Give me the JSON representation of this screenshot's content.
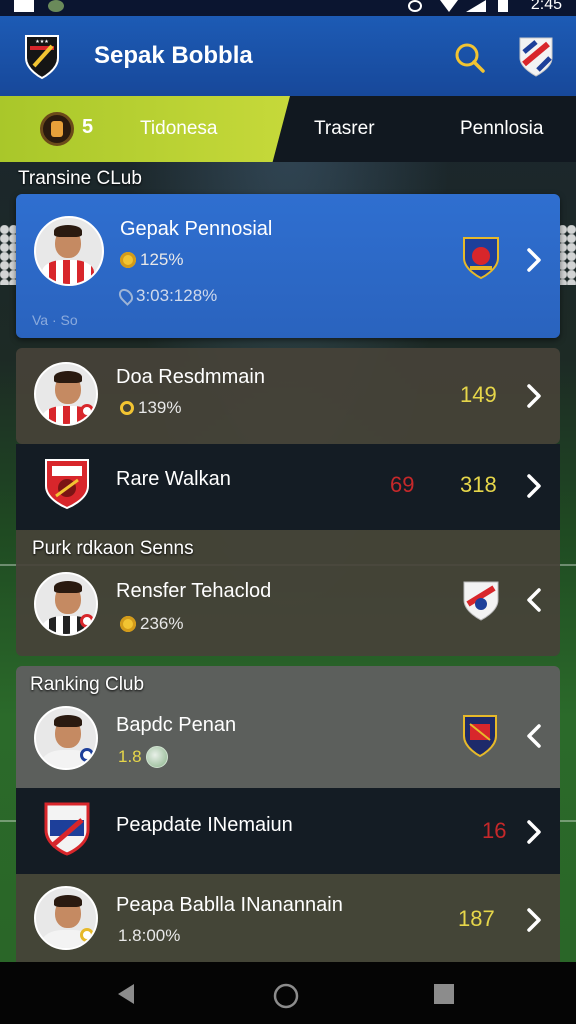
{
  "status_bar": {
    "time": "2:45"
  },
  "app_bar": {
    "title": "Sepak Bobbla"
  },
  "tabs": {
    "active": {
      "count": "5",
      "label": "Tidonesa"
    },
    "items": [
      {
        "label": "Trasrer"
      },
      {
        "label": "Pennlosia"
      }
    ]
  },
  "sections": {
    "transfer": {
      "label": "Transine CLub"
    },
    "featured": {
      "name": "Gepak Pennosial",
      "coins": "125%",
      "location": "3:03:128%",
      "watermark": "Va  ·  So"
    },
    "rows_a": [
      {
        "name": "Doa Resdmmain",
        "stat": "139%",
        "value": "149"
      },
      {
        "name": "Rare Walkan",
        "value_red": "69",
        "value": "318"
      }
    ],
    "purchase": {
      "label": "Purk rdkaon Senns",
      "row": {
        "name": "Rensfer Tehaclod",
        "stat": "236%"
      }
    },
    "ranking": {
      "label": "Ranking Club",
      "rows": [
        {
          "name": "Bapdc Penan",
          "stat": "1.8"
        },
        {
          "name": "Peapdate INemaiun",
          "value_red": "16"
        },
        {
          "name": "Peapa Bablla INanannain",
          "stat": "1.8:00%",
          "value": "187"
        }
      ]
    }
  },
  "colors": {
    "app_bar": "#1d5bb5",
    "active_tab": "#b5cc30",
    "card_blue": "#2f6fd0",
    "highlight_yellow": "#e6d64a",
    "highlight_red": "#c6282a"
  },
  "icons": {
    "app_logo": "club-crest-icon",
    "search": "search-icon",
    "club": "club-badge-icon",
    "chevron_right": "chevron-right-icon",
    "chevron_left": "chevron-left-icon",
    "nav_back": "back-triangle-icon",
    "nav_home": "home-circle-icon",
    "nav_recents": "recents-square-icon"
  }
}
